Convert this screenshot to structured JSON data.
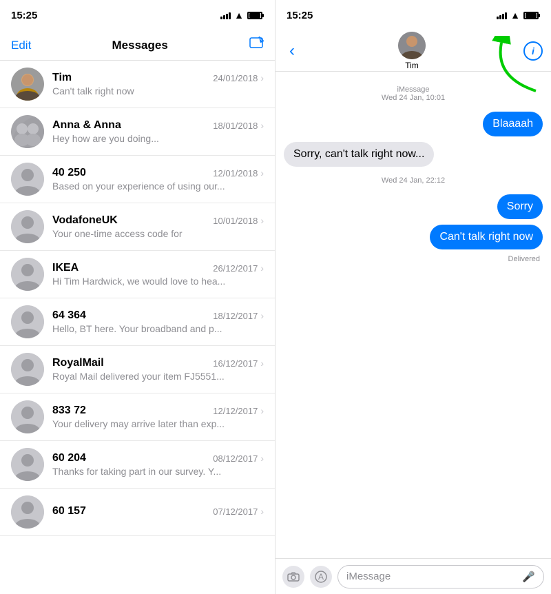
{
  "left": {
    "status_bar": {
      "time": "15:25"
    },
    "nav": {
      "edit": "Edit",
      "title": "Messages",
      "compose_icon": "✏"
    },
    "messages": [
      {
        "id": "tim",
        "name": "Tim",
        "date": "24/01/2018",
        "preview": "Can't talk right now",
        "avatar_type": "person_photo"
      },
      {
        "id": "anna",
        "name": "Anna & Anna",
        "date": "18/01/2018",
        "preview": "Hey how are you doing...",
        "avatar_type": "group"
      },
      {
        "id": "40250",
        "name": "40 250",
        "date": "12/01/2018",
        "preview": "Based on your experience of using our...",
        "avatar_type": "generic"
      },
      {
        "id": "vodafone",
        "name": "VodafoneUK",
        "date": "10/01/2018",
        "preview": "Your one-time access code for",
        "avatar_type": "generic"
      },
      {
        "id": "ikea",
        "name": "IKEA",
        "date": "26/12/2017",
        "preview": "Hi Tim Hardwick, we would love to hea...",
        "avatar_type": "generic"
      },
      {
        "id": "64364",
        "name": "64 364",
        "date": "18/12/2017",
        "preview": "Hello, BT here. Your broadband and p...",
        "avatar_type": "generic"
      },
      {
        "id": "royalmail",
        "name": "RoyalMail",
        "date": "16/12/2017",
        "preview": "Royal Mail delivered your item FJ5551...",
        "avatar_type": "generic"
      },
      {
        "id": "83372",
        "name": "833 72",
        "date": "12/12/2017",
        "preview": "Your delivery may arrive later than exp...",
        "avatar_type": "generic"
      },
      {
        "id": "60204",
        "name": "60 204",
        "date": "08/12/2017",
        "preview": "Thanks for taking part in our survey. Y...",
        "avatar_type": "generic"
      },
      {
        "id": "60157",
        "name": "60 157",
        "date": "07/12/2017",
        "preview": "",
        "avatar_type": "generic"
      }
    ]
  },
  "right": {
    "status_bar": {
      "time": "15:25"
    },
    "contact_name": "Tim",
    "chat": {
      "header_label": "iMessage",
      "header_date": "Wed 24 Jan, 10:01",
      "messages": [
        {
          "id": "m1",
          "text": "Blaaaah",
          "side": "right",
          "bubble": "blue"
        },
        {
          "id": "m2",
          "text": "Sorry, can't talk right now...",
          "side": "left",
          "bubble": "gray"
        },
        {
          "id": "m3",
          "timestamp": "Wed 24 Jan, 22:12"
        },
        {
          "id": "m4",
          "text": "Sorry",
          "side": "right",
          "bubble": "blue"
        },
        {
          "id": "m5",
          "text": "Can't talk right now",
          "side": "right",
          "bubble": "blue"
        }
      ],
      "delivered_label": "Delivered"
    },
    "input_bar": {
      "placeholder": "iMessage",
      "camera_icon": "📷",
      "appstore_icon": "⊕",
      "mic_icon": "🎤"
    }
  }
}
